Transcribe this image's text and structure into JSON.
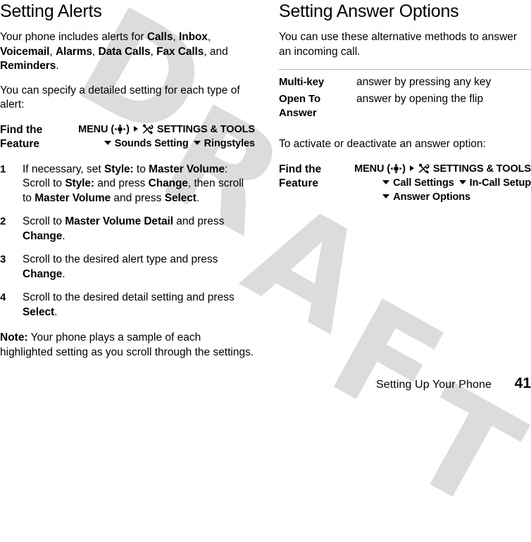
{
  "watermark": {
    "text": "DRAFT",
    "color": "#dcdcdc",
    "letters": [
      "D",
      "R",
      "A",
      "F",
      "T"
    ]
  },
  "left_column": {
    "title": "Setting Alerts",
    "paragraph_1": {
      "p1": "Your phone includes alerts for ",
      "b1": "Calls",
      "p2": ", ",
      "b2": "Inbox",
      "p3": ", ",
      "b3": "Voicemail",
      "p4": ", ",
      "b4": "Alarms",
      "p5": ", ",
      "b5": "Data Calls",
      "p6": ", ",
      "b6": "Fax Calls",
      "p7": ", and ",
      "b7": "Reminders",
      "p8": "."
    },
    "paragraph_2": "You can specify a detailed setting for each type of alert:",
    "find_the_feature": {
      "label_line_1": "Find the",
      "label_line_2": "Feature",
      "menu_word": "MENU",
      "paren_open": "(",
      "paren_close": ")",
      "settings_tools": "SETTINGS & TOOLS",
      "step_2": "Sounds Setting",
      "step_3": "Ringstyles"
    },
    "steps": [
      {
        "num": "1",
        "parts": [
          {
            "t": "If necessary, set ",
            "b": false
          },
          {
            "t": "Style:",
            "b": true
          },
          {
            "t": " to ",
            "b": false
          },
          {
            "t": "Master Volume",
            "b": true
          },
          {
            "t": ": Scroll to ",
            "b": false
          },
          {
            "t": "Style:",
            "b": true
          },
          {
            "t": " and press ",
            "b": false
          },
          {
            "t": "Change",
            "b": true
          },
          {
            "t": ", then scroll to ",
            "b": false
          },
          {
            "t": "Master Volume",
            "b": true
          },
          {
            "t": " and press ",
            "b": false
          },
          {
            "t": "Select",
            "b": true
          },
          {
            "t": ".",
            "b": false
          }
        ]
      },
      {
        "num": "2",
        "parts": [
          {
            "t": "Scroll to ",
            "b": false
          },
          {
            "t": "Master Volume Detail",
            "b": true
          },
          {
            "t": " and press ",
            "b": false
          },
          {
            "t": "Change",
            "b": true
          },
          {
            "t": ".",
            "b": false
          }
        ]
      },
      {
        "num": "3",
        "parts": [
          {
            "t": "Scroll to the desired alert type and press ",
            "b": false
          },
          {
            "t": "Change",
            "b": true
          },
          {
            "t": ".",
            "b": false
          }
        ]
      },
      {
        "num": "4",
        "parts": [
          {
            "t": "Scroll to the desired detail setting and press ",
            "b": false
          },
          {
            "t": "Select",
            "b": true
          },
          {
            "t": ".",
            "b": false
          }
        ]
      }
    ],
    "note": {
      "label": "Note:",
      "text": " Your phone plays a sample of each highlighted setting as you scroll through the settings."
    }
  },
  "right_column": {
    "title": "Setting Answer Options",
    "paragraph_1": "You can use these alternative methods to answer an incoming call.",
    "answer_options": [
      {
        "term": "Multi-key",
        "desc": "answer by pressing any key"
      },
      {
        "term": "Open To Answer",
        "desc": "answer by opening the flip"
      }
    ],
    "paragraph_2": "To activate or deactivate an answer option:",
    "find_the_feature": {
      "label_line_1": "Find the",
      "label_line_2": "Feature",
      "menu_word": "MENU",
      "paren_open": "(",
      "paren_close": ")",
      "settings_tools": "SETTINGS & TOOLS",
      "step_2": "Call Settings",
      "step_3": "In-Call Setup",
      "step_4": "Answer Options"
    }
  },
  "footer": {
    "title": "Setting Up Your Phone",
    "page_number": "41"
  },
  "icons": {
    "navpad": "navigation-pad-icon",
    "tools": "settings-tools-icon",
    "arrow_right": "arrow-right-icon",
    "arrow_down": "arrow-down-icon"
  }
}
